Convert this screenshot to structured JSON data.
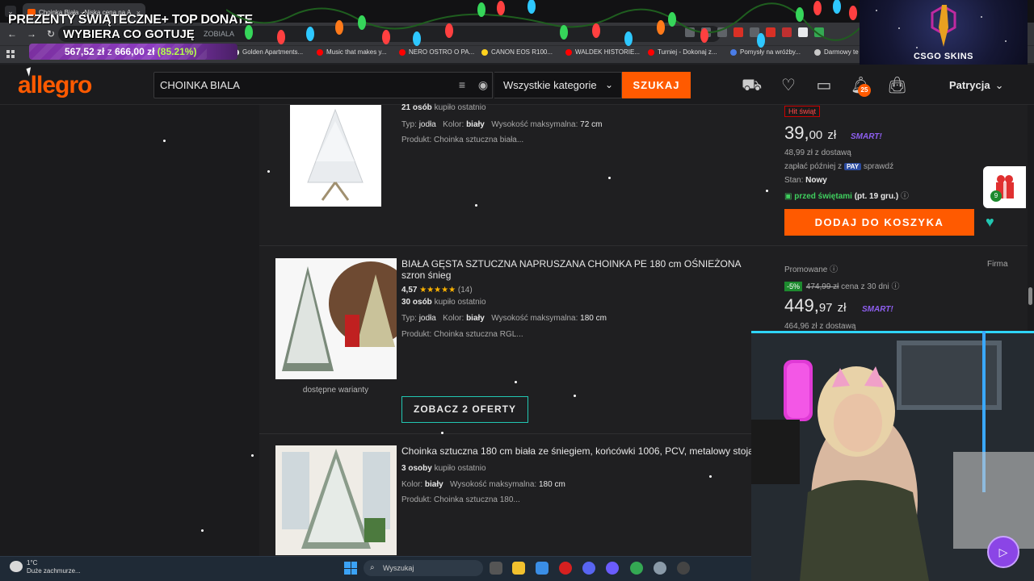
{
  "browser": {
    "tab_title": "Choinka Biała - Niska cena na A",
    "tab_close": "×",
    "tab_menu": "⌄",
    "url_partial": "ZOBIALA",
    "bookmarks": [
      {
        "label": "Golden Apartments...",
        "color": "#f2f2f2"
      },
      {
        "label": "Music that makes y...",
        "color": "#ff0000"
      },
      {
        "label": "NERO OSTRO O PA...",
        "color": "#ff0000"
      },
      {
        "label": "CANON EOS R100...",
        "color": "#ffd21e"
      },
      {
        "label": "WALDEK HISTORIE...",
        "color": "#ff0000"
      },
      {
        "label": "Turniej - Dokonaj z...",
        "color": "#ff0000"
      },
      {
        "label": "Pomysły na wróżby...",
        "color": "#4a7de8"
      },
      {
        "label": "Darmowy te",
        "color": "#c8c8c8"
      }
    ]
  },
  "donate": {
    "line1": "PREZENTY ŚWIĄTECZNE+ TOP DONATE",
    "line2": "WYBIERA CO GOTUJĘ",
    "amount": "567,52 zł",
    "separator": "z",
    "goal": "666,00 zł",
    "percent": "(85.21%)",
    "progress": 0.8521
  },
  "csgo": {
    "label": "CSGO SKINS"
  },
  "allegro": {
    "logo": "allegro",
    "search_value": "CHOINKA BIALA",
    "category": "Wszystkie kategorie",
    "search_button": "SZUKAJ",
    "notifications_count": "25",
    "user": "Patrycja"
  },
  "products": [
    {
      "buyers": "21 osób",
      "buyers_suffix": "kupiło ostatnio",
      "attrs": [
        {
          "k": "Typ:",
          "v": "jodła"
        },
        {
          "k": "Kolor:",
          "v": "biały"
        },
        {
          "k": "Wysokość maksymalna:",
          "v": "72 cm"
        }
      ],
      "product_line": "Produkt: Choinka sztuczna biała...",
      "badge": "Hit świąt",
      "price_main": "39,",
      "price_cents": "00",
      "price_currency": "zł",
      "smart": "SMART!",
      "delivery": "48,99 zł z dostawą",
      "pay_later": "zapłać później z",
      "pay_badge": "PAY",
      "pay_check": "sprawdź",
      "state_label": "Stan:",
      "state_value": "Nowy",
      "shipping": "przed świętami",
      "shipping_date": "(pt. 19 gru.)",
      "add_to_cart": "DODAJ DO KOSZYKA"
    },
    {
      "title": "BIAŁA GĘSTA SZTUCZNA NAPRUSZANA CHOINKA PE 180 cm OŚNIEŻONA szron śnieg",
      "rating": "4,57",
      "stars": "★★★★★",
      "reviews": "(14)",
      "buyers": "30 osób",
      "buyers_suffix": "kupiło ostatnio",
      "attrs": [
        {
          "k": "Typ:",
          "v": "jodła"
        },
        {
          "k": "Kolor:",
          "v": "biały"
        },
        {
          "k": "Wysokość maksymalna:",
          "v": "180 cm"
        }
      ],
      "product_line": "Produkt: Choinka sztuczna RGL...",
      "variants": "dostępne warianty",
      "offers_button": "ZOBACZ 2 OFERTY",
      "promoted": "Promowane",
      "seller_type": "Firma",
      "discount": "-5%",
      "old_price": "474,99 zł",
      "old_price_note": "cena z 30 dni",
      "price_main": "449,",
      "price_cents": "97",
      "price_currency": "zł",
      "smart": "SMART!",
      "delivery": "464,96 zł z dostawą"
    },
    {
      "title": "Choinka sztuczna 180 cm biała ze śniegiem, końcówki 1006, PCV, metalowy stoja",
      "buyers": "3 osoby",
      "buyers_suffix": "kupiło ostatnio",
      "attrs": [
        {
          "k": "Kolor:",
          "v": "biały"
        },
        {
          "k": "Wysokość maksymalna:",
          "v": "180 cm"
        }
      ],
      "product_line": "Produkt: Choinka sztuczna 180..."
    }
  ],
  "gift_count": "9",
  "taskbar": {
    "temp": "1°C",
    "weather": "Duże zachmurze...",
    "search": "Wyszukaj"
  }
}
